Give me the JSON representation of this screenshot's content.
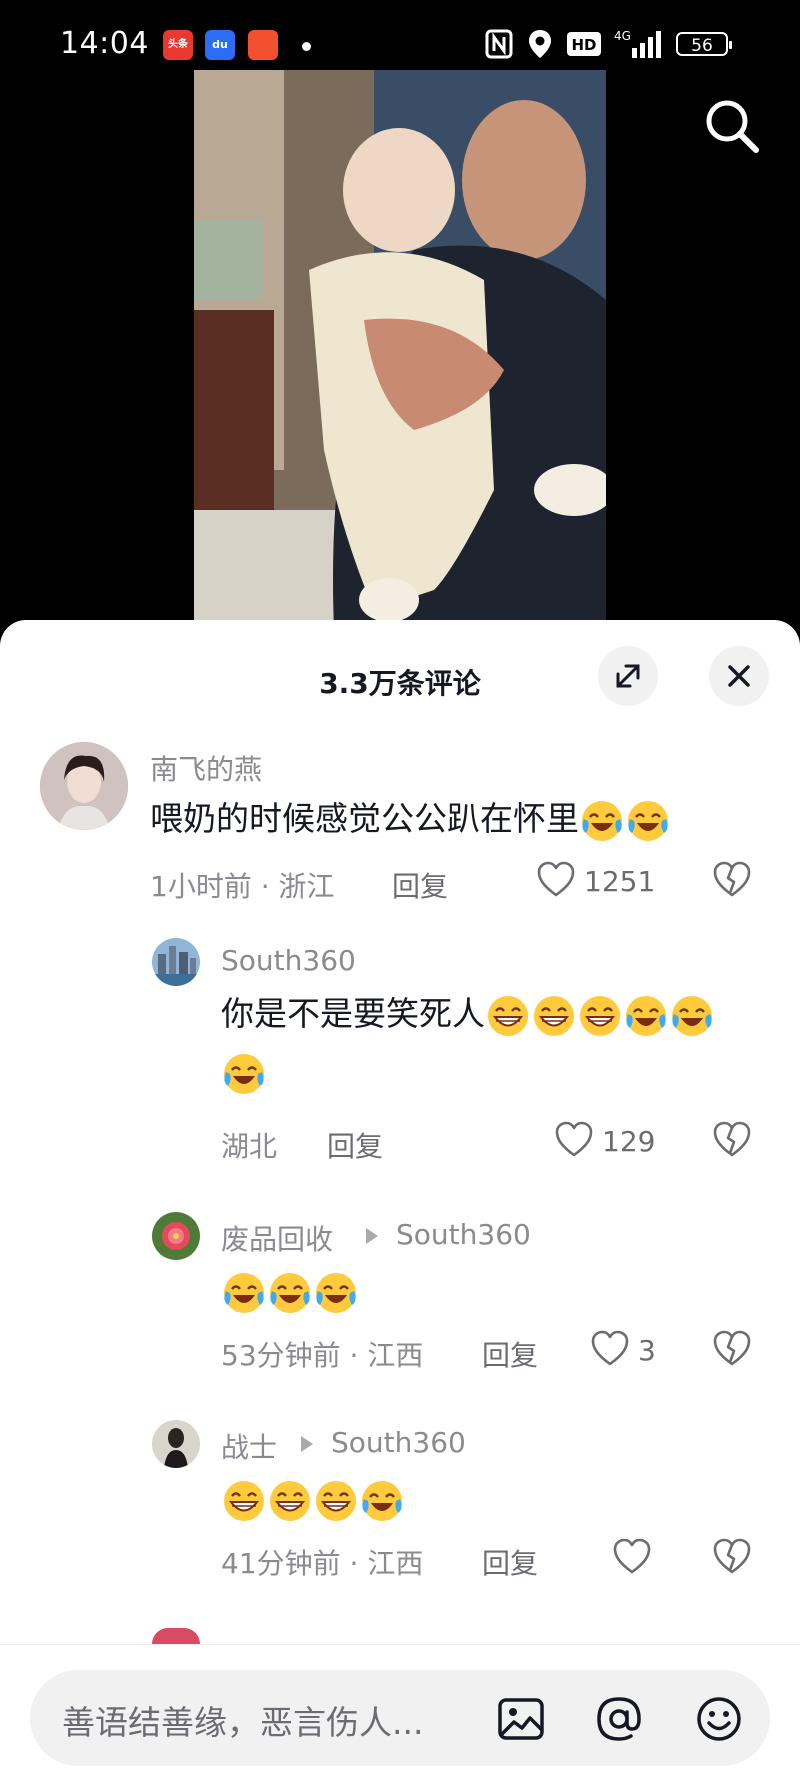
{
  "status_bar": {
    "time": "14:04",
    "app_badges": [
      "头条",
      "du",
      ""
    ],
    "network": "4G",
    "battery": "56"
  },
  "video": {
    "search_icon": "search-icon"
  },
  "panel": {
    "title": "3.3万条评论",
    "expand_icon": "expand-icon",
    "close_icon": "close-icon"
  },
  "comments": [
    {
      "username": "南飞的燕",
      "text": "喂奶的时候感觉公公趴在怀里",
      "emojis": [
        "laugh-cry",
        "laugh-cry"
      ],
      "meta": "1小时前 · 浙江",
      "reply_label": "回复",
      "likes": "1251"
    },
    {
      "username": "South360",
      "text": "你是不是要笑死人",
      "emojis": [
        "grin",
        "grin",
        "grin",
        "laugh-cry",
        "laugh-cry",
        "laugh-cry"
      ],
      "meta": "湖北",
      "reply_label": "回复",
      "likes": "129"
    },
    {
      "username": "废品回收",
      "reply_to": "South360",
      "text": "",
      "emojis": [
        "laugh-cry",
        "laugh-cry",
        "laugh-cry"
      ],
      "meta": "53分钟前 · 江西",
      "reply_label": "回复",
      "likes": "3"
    },
    {
      "username": "战士",
      "reply_to": "South360",
      "text": "",
      "emojis": [
        "grin",
        "grin",
        "grin",
        "laugh-cry"
      ],
      "meta": "41分钟前 · 江西",
      "reply_label": "回复",
      "likes": ""
    }
  ],
  "input": {
    "placeholder": "善语结善缘，恶言伤人...",
    "icons": [
      "image-icon",
      "mention-icon",
      "emoji-icon"
    ]
  },
  "colors": {
    "text_primary": "#161823",
    "text_secondary": "#8a8b91",
    "panel_bg": "#ffffff",
    "input_bg": "#f1f1f2"
  }
}
